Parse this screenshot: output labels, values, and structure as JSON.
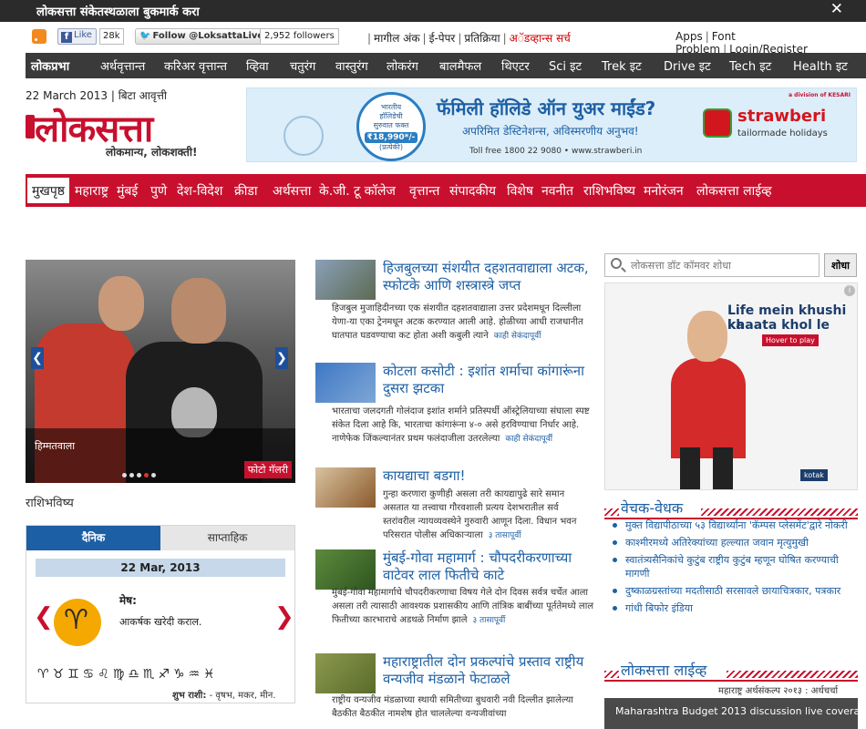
{
  "bookmark_bar": {
    "text": "लोकसत्ता संकेतस्थळाला बुकमार्क करा",
    "close": "✕"
  },
  "social": {
    "fb_like": "Like",
    "fb_count": "28k",
    "twitter_follow": "Follow @LoksattaLive",
    "twitter_count": "2,952 followers",
    "mid_links": [
      "मागील अंक",
      "ई-पेपर",
      "प्रतिक्रिया",
      "अॅडव्हान्स सर्च"
    ],
    "right_links": [
      "Apps",
      "Font Problem",
      "Login/Register"
    ]
  },
  "top_nav": [
    "लोकप्रभा",
    "अर्थवृत्तान्त",
    "करिअर वृत्तान्त",
    "व्हिवा",
    "चतुरंग",
    "वास्तुरंग",
    "लोकरंग",
    "बालमैफल",
    "थिएटर",
    "Sci इट",
    "Trek इट",
    "Drive इट",
    "Tech इट",
    "Health इट"
  ],
  "header": {
    "date": "22 March 2013",
    "edition": "बिटा आवृत्ती",
    "logo": "लोकसत्ता",
    "tagline": "लोकमान्य, लोकशक्ती!"
  },
  "ad_banner": {
    "badge_line1": "भारतीय",
    "badge_line2": "हॉलिडेची",
    "badge_line3": "सुरुवात फक्त",
    "badge_price": "₹18,990*/-",
    "badge_line4": "(प्रत्येकी)",
    "headline": "फॅमिली हॉलिडे ऑन युअर माईंड?",
    "subline": "अपरिमित डेस्टिनेशन्स, अविस्मरणीय अनुभव!",
    "toll": "Toll free 1800 22 9080  •  www.strawberi.in",
    "brand": "strawberi",
    "brand_sub": "tailormade holidays",
    "kesari": "a division of KESARI"
  },
  "main_nav": {
    "home": "मुखपृष्ठ",
    "items": [
      "महाराष्ट्र",
      "मुंबई",
      "पुणे",
      "देश-विदेश",
      "क्रीडा",
      "अर्थसत्ता",
      "के.जी. टू कॉलेज",
      "वृत्तान्त",
      "संपादकीय",
      "विशेष",
      "नवनीत",
      "राशिभविष्य",
      "मनोरंजन",
      "लोकसत्ता लाईव्ह"
    ]
  },
  "slider": {
    "caption": "हिम्मतवाला",
    "gallery_label": "फोटो गॅलरी",
    "arrow_left": "❮",
    "arrow_right": "❯",
    "dot_count": 5,
    "active_dot": 4
  },
  "rashi": {
    "title": "राशिभविष्य",
    "tab_daily": "दैनिक",
    "tab_weekly": "साप्ताहिक",
    "date": "22 Mar, 2013",
    "sign_name": "मेष:",
    "prediction": "आकर्षक खरेदी कराल.",
    "zodiac_row": "♈♉♊♋♌♍♎♏♐♑♒♓",
    "lucky_label": "शुभ राशी:",
    "lucky_value": "- वृषभ, मकर, मीन.",
    "arrow_left": "❮",
    "arrow_right": "❯"
  },
  "stories": [
    {
      "title": "हिजबुलच्या संशयीत दहशतवाद्याला अटक, स्फोटके आणि शस्त्रास्त्रे जप्त",
      "body": "हिजबुल मुजाहिदीनच्या एक संशयीत दहशतवाद्याला उत्तर प्रदेशमधून दिल्लीला येणा-या एका ट्रेनमधून अटक करण्यात आली आहे. होळीच्या आधी राजधानीत घातपात घडवण्याचा कट होता अशी कबुली त्याने",
      "meta": "काही सेकंदापूर्वी"
    },
    {
      "title": "कोटला कसोटी : इशांत शर्माचा कांगारूंना दुसरा झटका",
      "body": "भारताचा जलदगती गोलंदाज इशांत शर्माने प्रतिस्पर्धी ऑस्ट्रेलियाच्या संघाला स्पष्ट संकेत दिला आहे कि, भारताचा कांगारूंना ४-० असे हरविण्याचा निर्धार आहे. नाणेफेक जिंकल्यानंतर प्रथम फलंदाजीला उतरलेल्या",
      "meta": "काही सेकंदापूर्वी"
    },
    {
      "title": "कायद्याचा बडगा!",
      "body": "गुन्हा करणारा कुणीही असला तरी कायद्यापुढे सारे समान असतात या तत्त्वाचा गौरवशाली प्रत्यय देशभरातील सर्व स्तरांवरील न्यायव्यवस्थेने गुरुवारी आणून दिला. विधान भवन परिसरात पोलीस अधिकाऱ्याला",
      "meta": "३ तासापूर्वी"
    },
    {
      "title": "मुंबई-गोवा महामार्ग : चौपदरीकरणाच्या वाटेवर लाल फितीचे काटे",
      "body": "मुंबई-गोवा महामार्गाचे चौपदरीकरणाचा विषय गेले दोन दिवस सर्वत्र चर्चेत आला असला तरी त्यासाठी आवश्यक प्रशासकीय आणि तांत्रिक बाबींच्या पूर्ततेमध्ये लाल फितीच्या कारभाराचे अडथळे निर्माण झाले",
      "meta": "३ तासापूर्वी"
    },
    {
      "title": "महाराष्ट्रातील दोन प्रकल्पांचे प्रस्ताव राष्ट्रीय वन्यजीव मंडळाने फेटाळले",
      "body": "राष्ट्रीय वन्यजीव मंडळाच्या स्थायी समितीच्या बुधवारी नवी दिल्लीत झालेल्या बैठकीत बैठकीत नामशेष होत चाललेल्या वन्यजीवांच्या",
      "meta": ""
    }
  ],
  "search": {
    "placeholder": "लोकसत्ता डॉट कॉमवर शोधा",
    "value": "लोकसत्ता डॉट कॉमवर शोधा",
    "button": "शोधा"
  },
  "right_ad": {
    "line1": "Life mein khushi ka",
    "line2": "khaata khol le",
    "hover": "Hover to play",
    "brand": "kotak",
    "info": "i"
  },
  "vedh": {
    "title": "वेचक-वेधक",
    "items": [
      "मुक्त विद्यापीठाच्या ५३ विद्यार्थ्यांना 'कॅम्पस प्लेसमेंट'द्वारे नोकरी",
      "काश्मीरमध्ये अतिरेक्यांच्या हल्ल्यात जवान मृत्युमुखी",
      "स्वातंत्र्यसैनिकांचे कुटुंब राष्ट्रीय कुटुंब म्हणून घोषित करण्याची मागणी",
      "दुष्काळग्रस्तांच्या मदतीसाठी सरसावले छायाचित्रकार, पत्रकार",
      "गांधी बिफोर इंडिया"
    ]
  },
  "live": {
    "title": "लोकसत्ता लाईव्ह",
    "subtitle": "महाराष्ट्र अर्थसंकल्प २०१३ : अर्थचर्चा",
    "box_text": "Maharashtra Budget 2013 discussion live coverage"
  },
  "colors": {
    "brand_red": "#c8102e",
    "link_blue": "#1d5fa4",
    "dark_nav": "#3a3a3a"
  }
}
